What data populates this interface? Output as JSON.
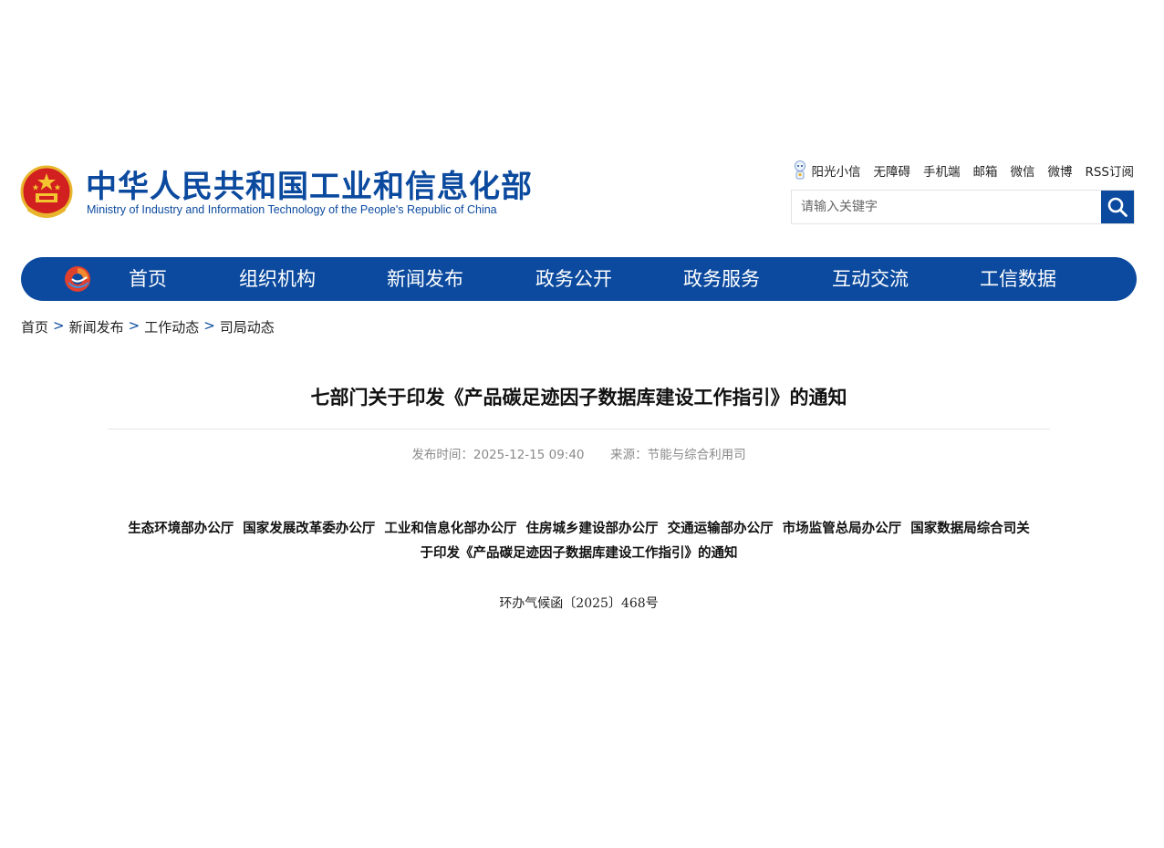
{
  "header": {
    "site_name_cn": "中华人民共和国工业和信息化部",
    "site_name_en": "Ministry of Industry and Information Technology of the People's Republic of China",
    "emblem_icon": "national-emblem-icon",
    "top_links": [
      "阳光小信",
      "无障碍",
      "手机端",
      "邮箱",
      "微信",
      "微博",
      "RSS订阅"
    ],
    "search": {
      "placeholder": "请输入关键字",
      "value": "",
      "icon": "search-icon"
    }
  },
  "nav": {
    "logo_icon": "miit-logo-icon",
    "items": [
      "首页",
      "组织机构",
      "新闻发布",
      "政务公开",
      "政务服务",
      "互动交流",
      "工信数据"
    ]
  },
  "breadcrumb": {
    "items": [
      "首页",
      "新闻发布",
      "工作动态",
      "司局动态"
    ],
    "separator": ">"
  },
  "article": {
    "title": "七部门关于印发《产品碳足迹因子数据库建设工作指引》的通知",
    "publish_time_label": "发布时间：2025-12-15 09:40",
    "source_label": "来源：节能与综合利用司",
    "heading_line1": "生态环境部办公厅  国家发展改革委办公厅  工业和信息化部办公厅  住房城乡建设部办公厅  交通运输部办公厅  市场监管总局办公厅  国家数据局综合司关",
    "heading_line2": "于印发《产品碳足迹因子数据库建设工作指引》的通知",
    "doc_number": "环办气候函〔2025〕468号"
  },
  "colors": {
    "brand_blue": "#0b4a9e",
    "meta_gray": "#8a8a8a"
  }
}
